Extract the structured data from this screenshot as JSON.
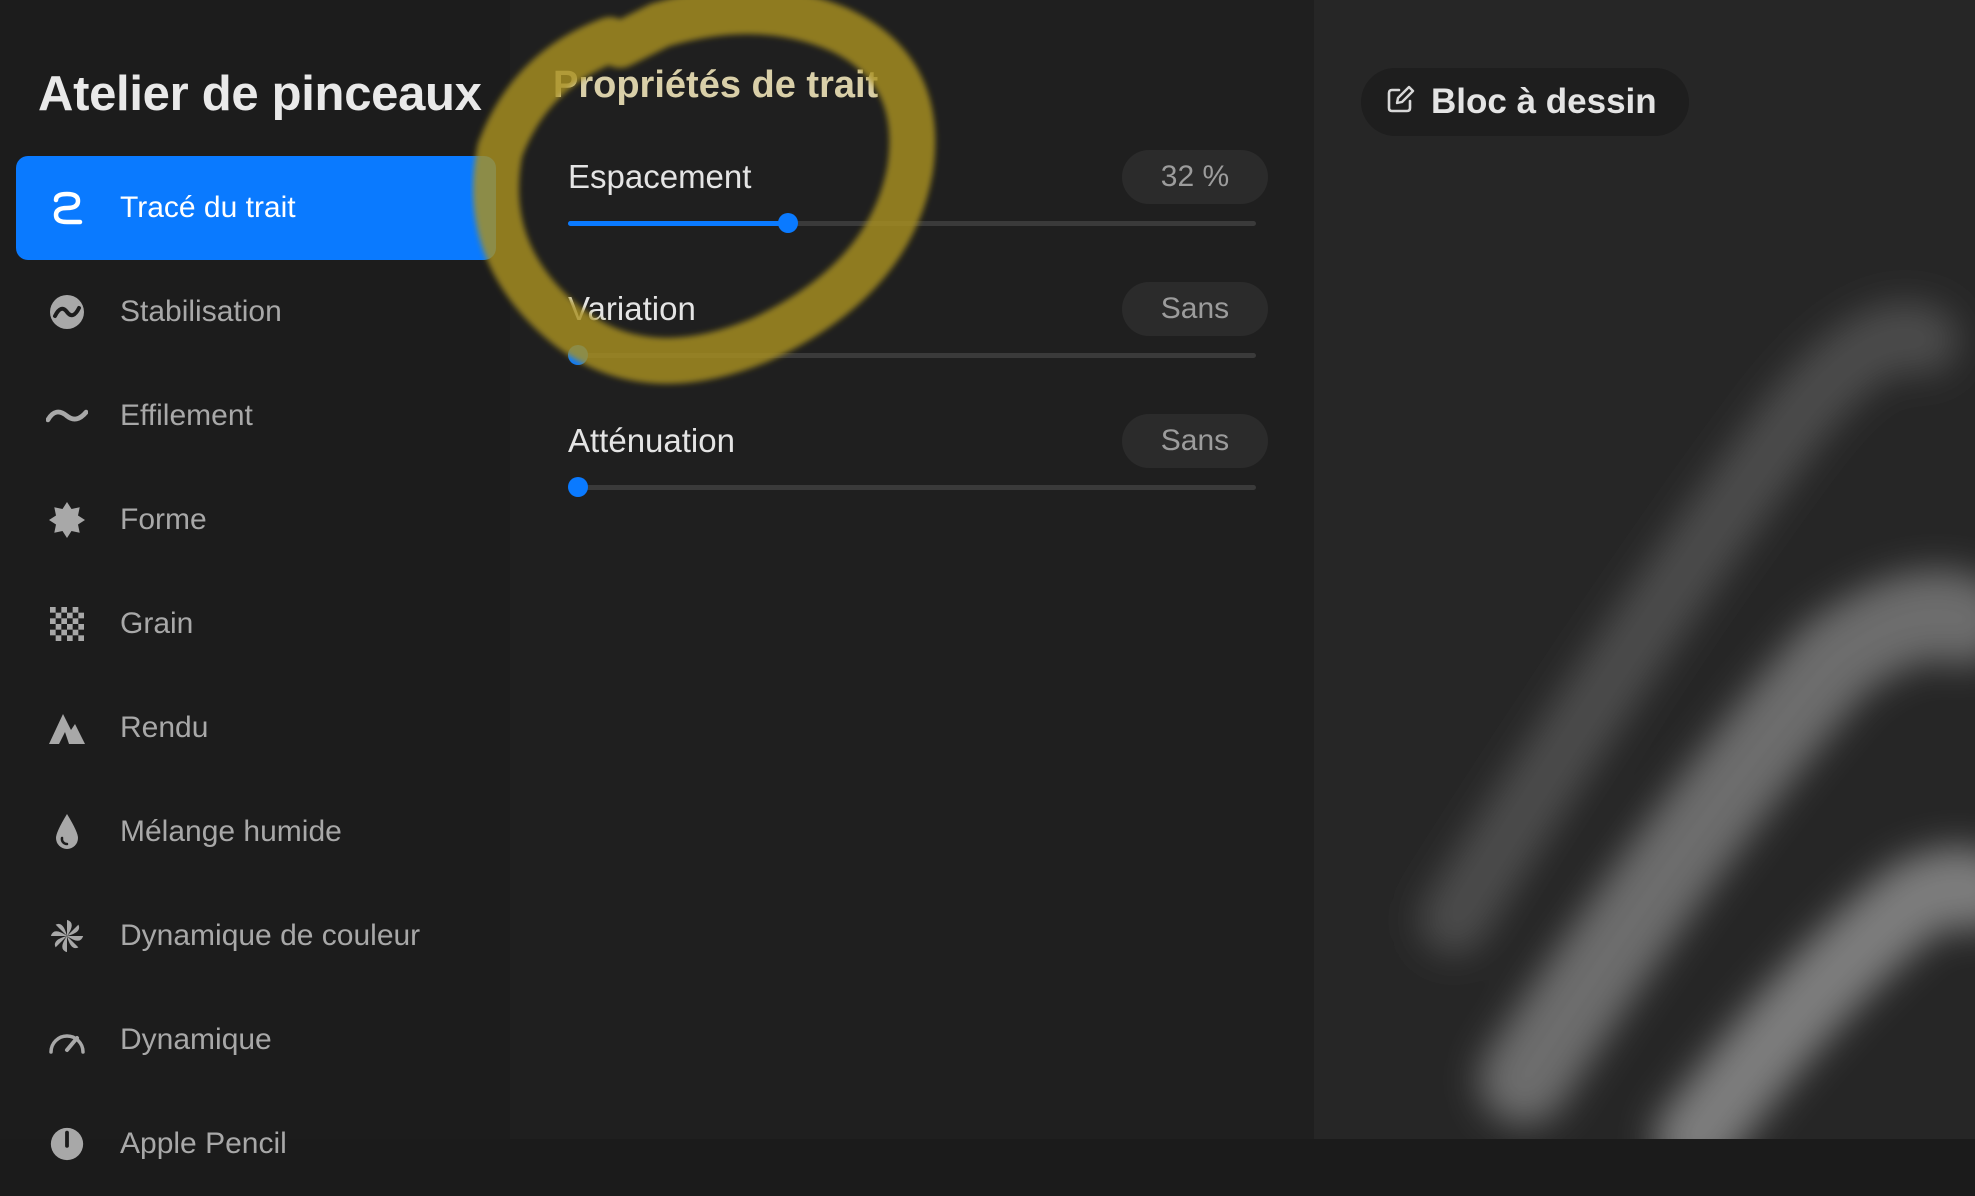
{
  "sidebar": {
    "title": "Atelier de pinceaux",
    "items": [
      {
        "label": "Tracé du trait",
        "icon": "stroke-path-icon",
        "active": true
      },
      {
        "label": "Stabilisation",
        "icon": "stabilization-icon",
        "active": false
      },
      {
        "label": "Effilement",
        "icon": "taper-wave-icon",
        "active": false
      },
      {
        "label": "Forme",
        "icon": "shape-badge-icon",
        "active": false
      },
      {
        "label": "Grain",
        "icon": "grain-checker-icon",
        "active": false
      },
      {
        "label": "Rendu",
        "icon": "rendering-icon",
        "active": false
      },
      {
        "label": "Mélange humide",
        "icon": "water-drop-icon",
        "active": false
      },
      {
        "label": "Dynamique de couleur",
        "icon": "pinwheel-icon",
        "active": false
      },
      {
        "label": "Dynamique",
        "icon": "speedometer-icon",
        "active": false
      },
      {
        "label": "Apple Pencil",
        "icon": "pencil-icon",
        "active": false
      }
    ]
  },
  "panel": {
    "title": "Propriétés de trait",
    "settings": [
      {
        "name": "Espacement",
        "value": "32 %",
        "level": 0.32
      },
      {
        "name": "Variation",
        "value": "Sans",
        "level": 0
      },
      {
        "name": "Atténuation",
        "value": "Sans",
        "level": 0
      }
    ]
  },
  "preview": {
    "pad_button_label": "Bloc à dessin",
    "pad_button_icon": "edit-square-icon"
  },
  "colors": {
    "accent": "#0a7aff",
    "annotation": "#b8a030",
    "background": "#1b1b1b"
  }
}
